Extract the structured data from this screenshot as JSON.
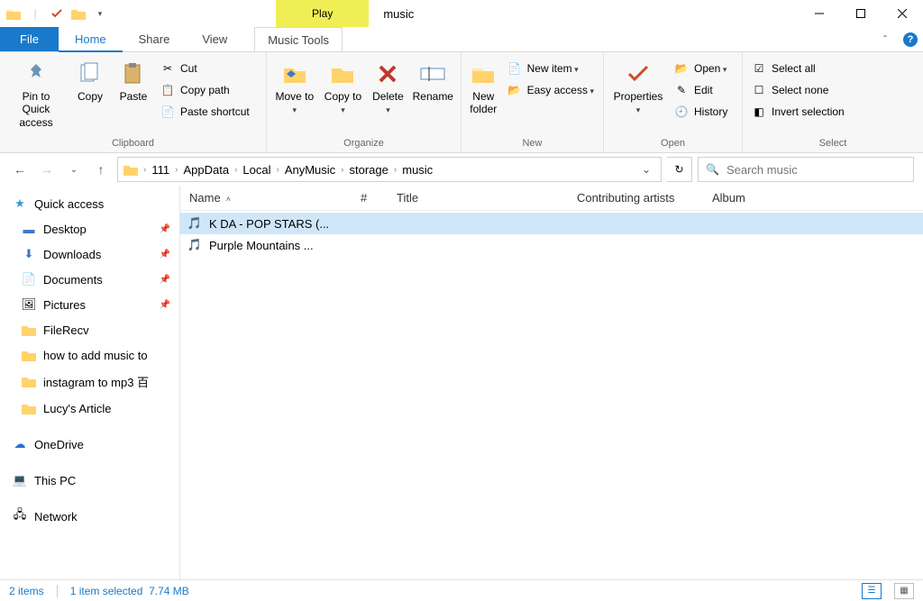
{
  "titlebar": {
    "context_tab": "Play",
    "window_title": "music"
  },
  "tabs": {
    "file": "File",
    "items": [
      "Home",
      "Share",
      "View"
    ],
    "context_tool": "Music Tools"
  },
  "ribbon": {
    "clipboard": {
      "label": "Clipboard",
      "pin": "Pin to Quick access",
      "copy": "Copy",
      "paste": "Paste",
      "cut": "Cut",
      "copy_path": "Copy path",
      "paste_shortcut": "Paste shortcut"
    },
    "organize": {
      "label": "Organize",
      "move_to": "Move to",
      "copy_to": "Copy to",
      "delete": "Delete",
      "rename": "Rename"
    },
    "new": {
      "label": "New",
      "new_folder": "New folder",
      "new_item": "New item",
      "easy_access": "Easy access"
    },
    "open": {
      "label": "Open",
      "properties": "Properties",
      "open": "Open",
      "edit": "Edit",
      "history": "History"
    },
    "select": {
      "label": "Select",
      "select_all": "Select all",
      "select_none": "Select none",
      "invert": "Invert selection"
    }
  },
  "breadcrumbs": [
    "111",
    "AppData",
    "Local",
    "AnyMusic",
    "storage",
    "music"
  ],
  "search": {
    "placeholder": "Search music"
  },
  "nav": {
    "quick_access": "Quick access",
    "pinned": [
      "Desktop",
      "Downloads",
      "Documents",
      "Pictures"
    ],
    "recent": [
      "FileRecv",
      "how to add music to",
      "instagram to mp3 百",
      "Lucy's Article"
    ],
    "onedrive": "OneDrive",
    "this_pc": "This PC",
    "network": "Network"
  },
  "columns": {
    "name": "Name",
    "num": "#",
    "title": "Title",
    "artists": "Contributing artists",
    "album": "Album"
  },
  "files": [
    {
      "name": "K DA - POP STARS (...",
      "selected": true
    },
    {
      "name": "Purple Mountains  ...",
      "selected": false
    }
  ],
  "status": {
    "count": "2 items",
    "selection": "1 item selected",
    "size": "7.74 MB"
  }
}
